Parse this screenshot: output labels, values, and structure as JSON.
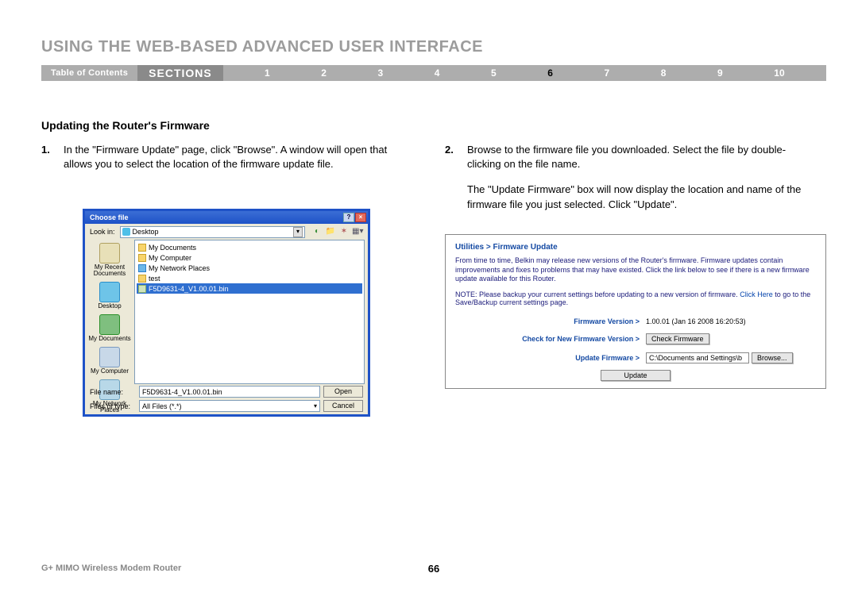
{
  "pageTitle": "USING THE WEB-BASED ADVANCED USER INTERFACE",
  "nav": {
    "toc": "Table of Contents",
    "sectionsLabel": "SECTIONS",
    "numbers": [
      "1",
      "2",
      "3",
      "4",
      "5",
      "6",
      "7",
      "8",
      "9",
      "10"
    ],
    "activeIndex": 5
  },
  "heading": "Updating the Router's Firmware",
  "step1": {
    "num": "1.",
    "text": "In the \"Firmware Update\" page, click \"Browse\". A window will open that allows you to select the location of the firmware update file."
  },
  "step2": {
    "num": "2.",
    "text": "Browse to the firmware file you downloaded. Select the file by double-clicking on the file name."
  },
  "para2": "The \"Update Firmware\" box will now display the location and name of the firmware file you just selected. Click \"Update\".",
  "dialog": {
    "title": "Choose file",
    "lookInLabel": "Look in:",
    "lookInValue": "Desktop",
    "sidebar": [
      "My Recent Documents",
      "Desktop",
      "My Documents",
      "My Computer",
      "My Network Places"
    ],
    "files": [
      {
        "type": "folder",
        "name": "My Documents"
      },
      {
        "type": "folder",
        "name": "My Computer"
      },
      {
        "type": "net",
        "name": "My Network Places"
      },
      {
        "type": "folder",
        "name": "test"
      },
      {
        "type": "bin",
        "name": "F5D9631-4_V1.00.01.bin",
        "selected": true
      }
    ],
    "fileNameLabel": "File name:",
    "fileNameValue": "F5D9631-4_V1.00.01.bin",
    "fileTypeLabel": "Files of type:",
    "fileTypeValue": "All Files (*.*)",
    "openBtn": "Open",
    "cancelBtn": "Cancel"
  },
  "panel": {
    "title": "Utilities > Firmware Update",
    "desc": "From time to time, Belkin may release new versions of the Router's firmware. Firmware updates contain improvements and fixes to problems that may have existed. Click the link below to see if there is a new firmware update available for this Router.",
    "note_pre": "NOTE: Please backup your current settings before updating to a new version of firmware.",
    "note_link": "Click Here",
    "note_post": " to go to the Save/Backup current settings page.",
    "rows": {
      "versionLabel": "Firmware Version >",
      "versionValue": "1.00.01 (Jan 16 2008 16:20:53)",
      "checkLabel": "Check for New Firmware Version >",
      "checkBtn": "Check Firmware",
      "updateLabel": "Update Firmware >",
      "updateInput": "C:\\Documents and Settings\\b",
      "browseBtn": "Browse..."
    },
    "updateBtn": "Update"
  },
  "footer": {
    "product": "G+ MIMO Wireless Modem Router",
    "page": "66"
  }
}
